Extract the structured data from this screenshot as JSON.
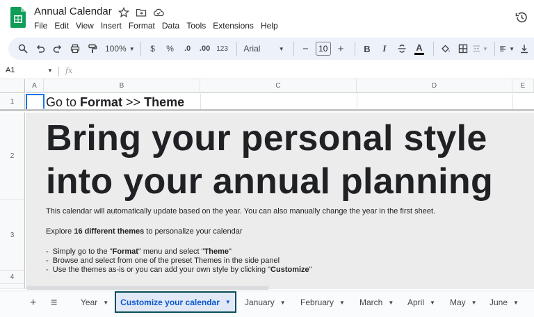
{
  "window": {
    "doc_title": "Annual Calendar",
    "menu": [
      "File",
      "Edit",
      "View",
      "Insert",
      "Format",
      "Data",
      "Tools",
      "Extensions",
      "Help"
    ]
  },
  "toolbar": {
    "zoom": "100%",
    "currency": "$",
    "percent": "%",
    "dec_decrease": ".0",
    "dec_increase": ".00",
    "number_format": "123",
    "font": "Arial",
    "font_size": "10",
    "minus": "−",
    "plus": "+",
    "bold": "B",
    "italic": "I",
    "text_color": "A"
  },
  "formula_bar": {
    "cell_ref": "A1",
    "fx": "fx"
  },
  "columns": [
    "A",
    "B",
    "C",
    "D",
    "E"
  ],
  "rows": [
    "1",
    "2",
    "3",
    "4"
  ],
  "sheet": {
    "row1_prefix": "Go to ",
    "row1_format": "Format",
    "row1_arrow": " >> ",
    "row1_theme": "Theme",
    "headline_line1": "Bring your personal style",
    "headline_line2": "into your annual planning",
    "para1": "This calendar will automatically update based on the year. You can also manually change the year in the first sheet.",
    "para2_prefix": "Explore ",
    "para2_bold": "16 different themes",
    "para2_suffix": " to personalize your calendar",
    "bullet1_a": "-  Simply go to the \"",
    "bullet1_b": "Format",
    "bullet1_c": "\" menu and select \"",
    "bullet1_d": "Theme",
    "bullet1_e": "\"",
    "bullet2": "-  Browse and select from one of the preset Themes in the side panel",
    "bullet3_a": "-  Use the themes as-is or you can add your own style by clicking \"",
    "bullet3_b": "Customize",
    "bullet3_c": "\""
  },
  "colors": {
    "band1": "#2d4a7a",
    "band2": "#f5cdb6",
    "band3": "#3e8a6c",
    "active_tab_border": "#0b4e5b",
    "selection": "#1a73e8"
  },
  "tabs": {
    "add": "+",
    "list": "≡",
    "items": [
      "Year",
      "Customize your calendar",
      "January",
      "February",
      "March",
      "April",
      "May",
      "June"
    ],
    "active": "Customize your calendar"
  }
}
